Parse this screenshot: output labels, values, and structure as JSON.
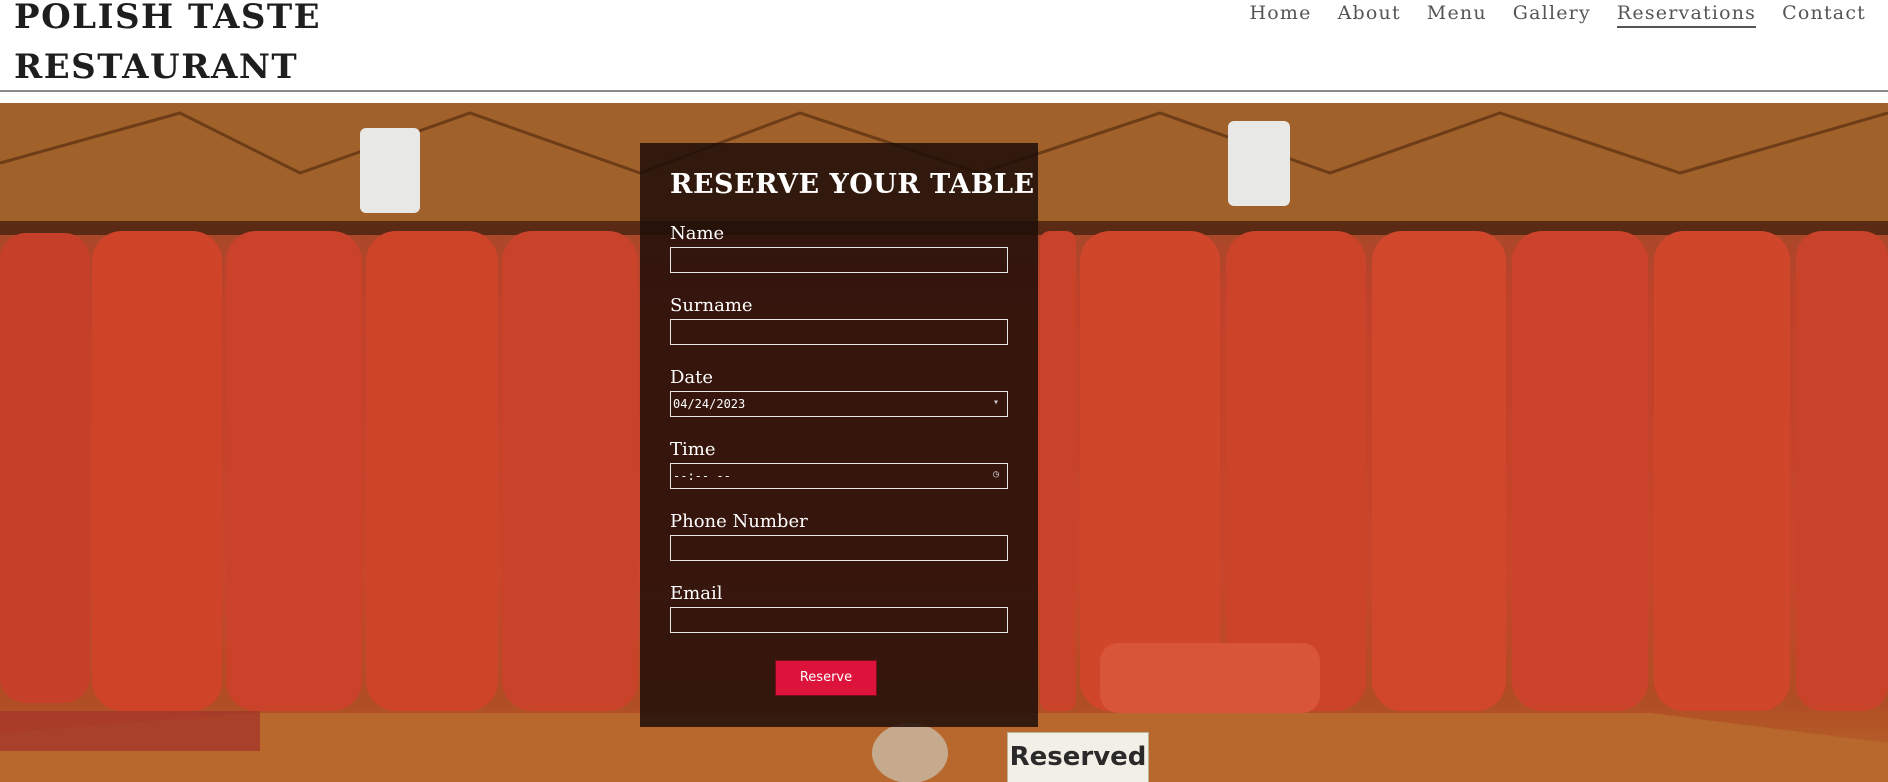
{
  "header": {
    "brand_line1": "POLISH TASTE",
    "brand_line2": "RESTAURANT",
    "nav": [
      {
        "label": "Home"
      },
      {
        "label": "About"
      },
      {
        "label": "Menu"
      },
      {
        "label": "Gallery"
      },
      {
        "label": "Reservations",
        "active": true
      },
      {
        "label": "Contact"
      }
    ]
  },
  "form": {
    "title": "RESERVE YOUR TABLE",
    "fields": [
      {
        "label": "Name",
        "value": ""
      },
      {
        "label": "Surname",
        "value": ""
      },
      {
        "label": "Date",
        "value": "04/24/2023"
      },
      {
        "label": "Time",
        "value": "--:-- --"
      },
      {
        "label": "Phone Number",
        "value": ""
      },
      {
        "label": "Email",
        "value": ""
      }
    ],
    "submit_label": "Reserve"
  },
  "hero": {
    "sign_text": "Reserved"
  },
  "colors": {
    "accent": "#dc143c",
    "panel": "#1e0e08",
    "booth": "#c9452b"
  }
}
